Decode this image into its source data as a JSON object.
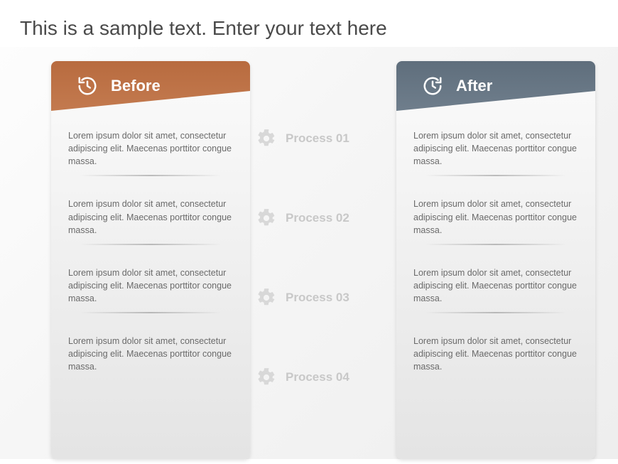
{
  "title": "This is a sample text. Enter your text here",
  "before": {
    "label": "Before",
    "items": [
      "Lorem ipsum dolor sit amet, consectetur adipiscing elit. Maecenas porttitor congue massa.",
      "Lorem ipsum dolor sit amet, consectetur adipiscing elit. Maecenas porttitor congue massa.",
      "Lorem ipsum dolor sit amet, consectetur adipiscing elit. Maecenas porttitor congue massa.",
      "Lorem ipsum dolor sit amet, consectetur adipiscing elit. Maecenas porttitor congue massa."
    ]
  },
  "after": {
    "label": "After",
    "items": [
      "Lorem ipsum dolor sit amet, consectetur adipiscing elit. Maecenas porttitor congue massa.",
      "Lorem ipsum dolor sit amet, consectetur adipiscing elit. Maecenas porttitor congue massa.",
      "Lorem ipsum dolor sit amet, consectetur adipiscing elit. Maecenas porttitor congue massa.",
      "Lorem ipsum dolor sit amet, consectetur adipiscing elit. Maecenas porttitor congue massa."
    ]
  },
  "processes": [
    {
      "label": "Process 01"
    },
    {
      "label": "Process 02"
    },
    {
      "label": "Process 03"
    },
    {
      "label": "Process 04"
    }
  ],
  "colors": {
    "before_header": "#c07548",
    "after_header": "#6b7a88",
    "process_text": "#c8c8c8"
  }
}
